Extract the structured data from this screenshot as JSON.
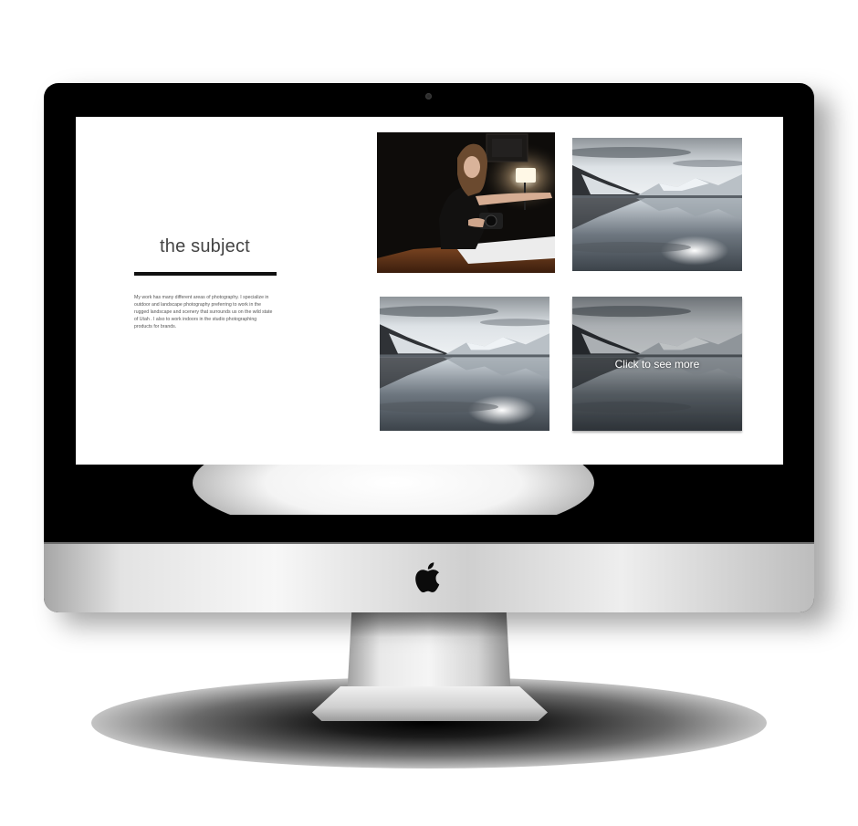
{
  "page": {
    "title": "the subject",
    "description": "My work has many different areas of photography. I specialize in outdoor and landscape photography preferring to work in the rugged landscape and scenery that surrounds us on the wild state of Utah . I also to work indoors in the studio photographing products for brands."
  },
  "gallery": {
    "photos": [
      {
        "subject": "photographer-in-studio"
      },
      {
        "subject": "mountain-lake-reflection"
      },
      {
        "subject": "mountain-lake-reflection"
      },
      {
        "subject": "mountain-lake-reflection",
        "overlay_text": "Click to see more"
      }
    ]
  },
  "colors": {
    "accent_rule": "#111111",
    "title_text": "#444444",
    "screen_bg": "#ffffff",
    "bezel": "#000000"
  },
  "device": {
    "type": "desktop-monitor",
    "logo": "apple-icon"
  }
}
